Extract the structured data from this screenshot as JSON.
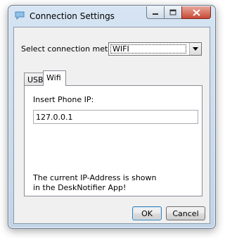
{
  "window": {
    "title": "Connection Settings",
    "icon": "speech-bubble-icon",
    "controls": [
      "minimize-icon",
      "maximize-icon",
      "close-icon"
    ]
  },
  "connection": {
    "label": "Select connection method:",
    "selected": "WIFI"
  },
  "tabs": [
    {
      "label": "USB",
      "active": false
    },
    {
      "label": "Wifi",
      "active": true
    }
  ],
  "wifi": {
    "ip_label": "Insert Phone IP:",
    "ip_value": "127.0.0.1",
    "info": "The current IP-Address is shown\nin the DeskNotifier App!"
  },
  "buttons": {
    "ok": "OK",
    "cancel": "Cancel"
  },
  "colors": {
    "title_bar": "#c9daee",
    "close_button": "#c94a36",
    "default_button_border": "#3c7fb1"
  }
}
